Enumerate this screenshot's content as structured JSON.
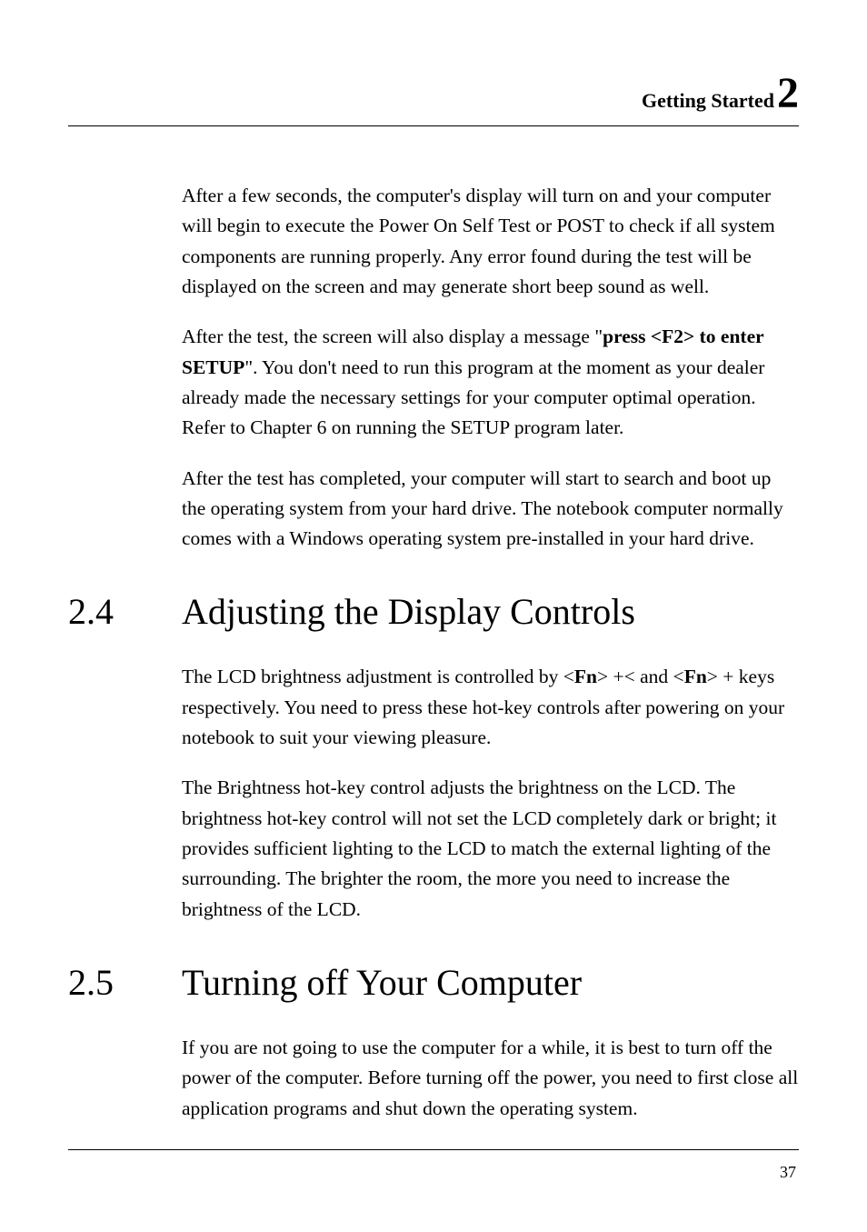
{
  "header": {
    "label": "Getting Started",
    "chapter_number": "2"
  },
  "paragraphs": {
    "p1": "After a few seconds, the computer's display will turn on and your computer will begin to execute the Power On Self Test or POST to check if all system components are running properly. Any error found during the test will be displayed on the screen and may generate short beep sound as well.",
    "p2_part1": "After the test, the screen will also display a message \"",
    "p2_bold": "press <F2> to enter SETUP",
    "p2_part2": "\". You don't need to run this program at the moment as your dealer already made the necessary settings for your computer optimal operation. Refer to Chapter 6 on running the SETUP program later.",
    "p3": "After the test has completed, your computer will start to search and boot up the operating system from your hard drive. The notebook computer normally comes with a Windows operating system pre-installed in your hard drive.",
    "p4_part1": "The LCD brightness adjustment is controlled by <",
    "p4_fn1": "Fn",
    "p4_part2": "> +<       and <",
    "p4_fn2": "Fn",
    "p4_part3": "> +        keys respectively. You need to press these hot-key controls after powering on your notebook to suit your viewing pleasure.",
    "p5": "The Brightness hot-key control adjusts the brightness on the LCD. The brightness hot-key control will not set the LCD completely dark or bright; it provides sufficient lighting to the LCD to match the external lighting of the surrounding. The brighter the room, the more you need to increase the brightness of the LCD.",
    "p6": "If you are not going to use the computer for a while, it is best to turn off the power of the computer. Before turning off the power, you need to first close all application programs and shut down the operating system."
  },
  "sections": {
    "s24_num": "2.4",
    "s24_title": "Adjusting the Display Controls",
    "s25_num": "2.5",
    "s25_title": "Turning off Your Computer"
  },
  "footer": {
    "page_number": "37"
  }
}
